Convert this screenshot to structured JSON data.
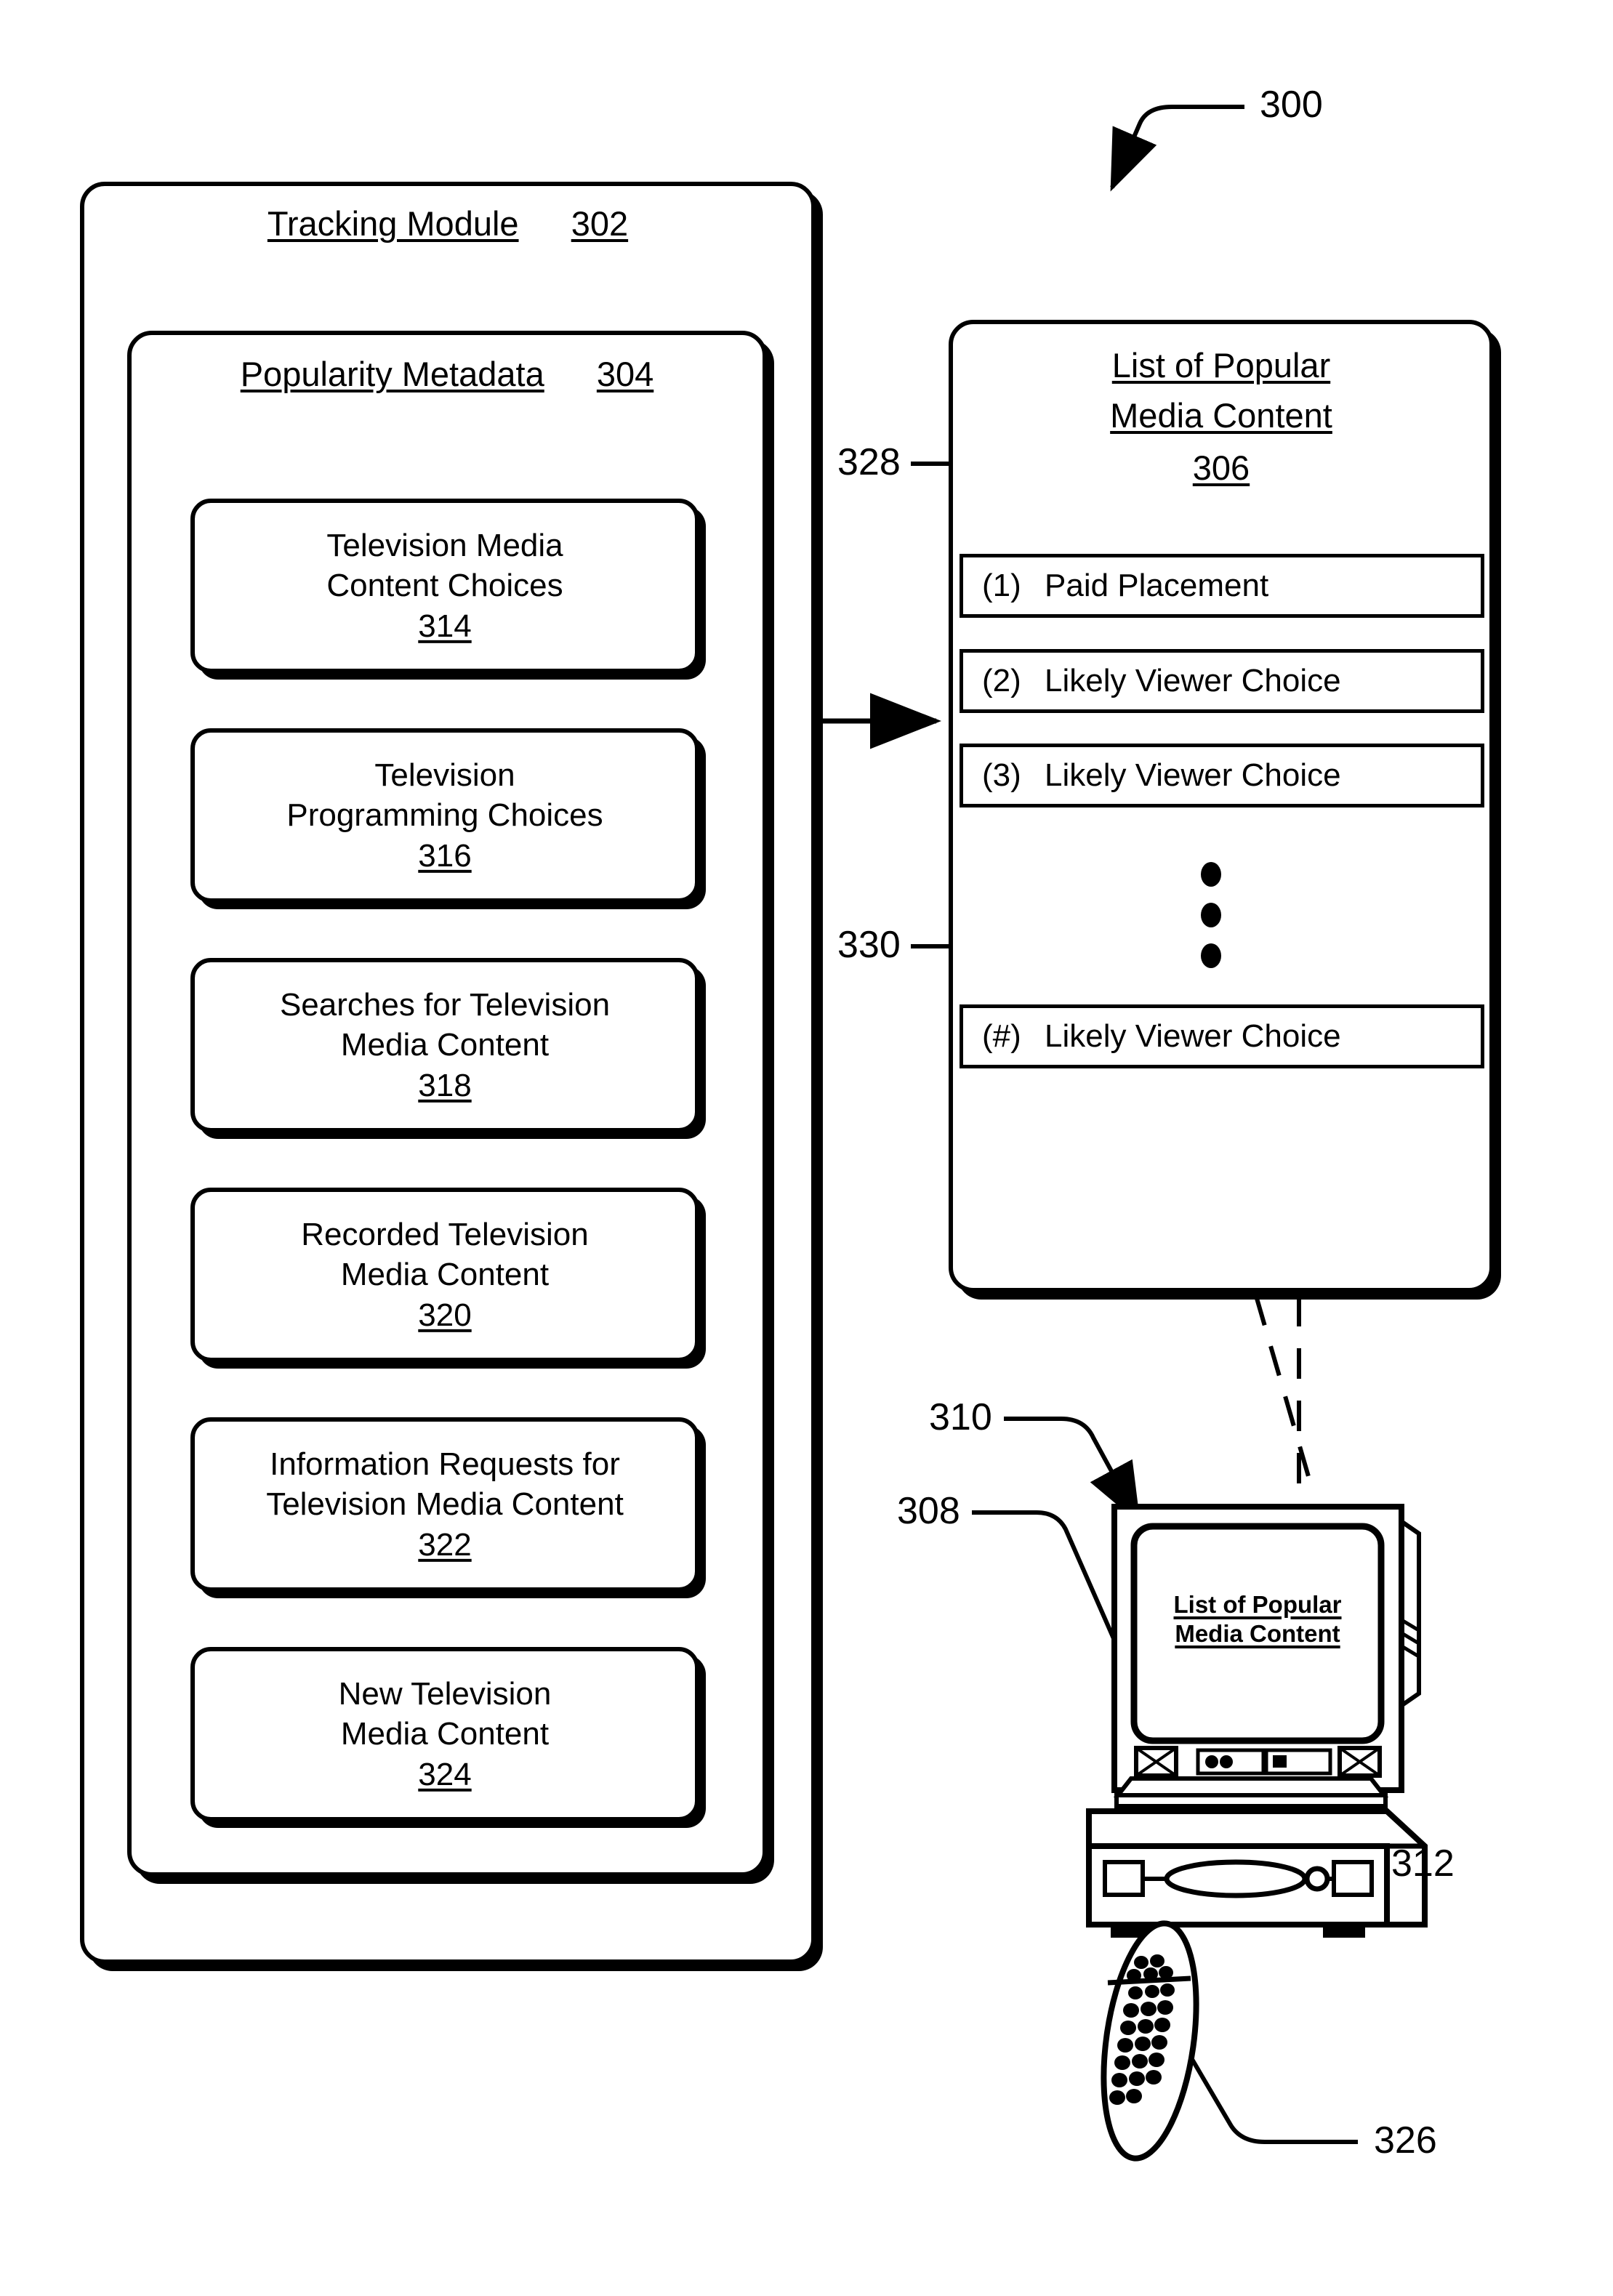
{
  "figure": {
    "number": "300"
  },
  "tracking_module": {
    "title": "Tracking Module",
    "ref": "302"
  },
  "popularity_metadata": {
    "title": "Popularity Metadata",
    "ref": "304",
    "items": [
      {
        "lines": [
          "Television Media",
          "Content Choices"
        ],
        "ref": "314"
      },
      {
        "lines": [
          "Television",
          "Programming Choices"
        ],
        "ref": "316"
      },
      {
        "lines": [
          "Searches for Television",
          "Media Content"
        ],
        "ref": "318"
      },
      {
        "lines": [
          "Recorded Television",
          "Media Content"
        ],
        "ref": "320"
      },
      {
        "lines": [
          "Information Requests for",
          "Television Media Content"
        ],
        "ref": "322"
      },
      {
        "lines": [
          "New Television",
          "Media Content"
        ],
        "ref": "324"
      }
    ]
  },
  "popular_list": {
    "title_line1": "List of Popular",
    "title_line2": "Media Content",
    "ref": "306",
    "first_item_ref": "328",
    "ellipsis_ref": "330",
    "rows": [
      {
        "rank": "(1)",
        "text": "Paid Placement"
      },
      {
        "rank": "(2)",
        "text": "Likely Viewer Choice"
      },
      {
        "rank": "(3)",
        "text": "Likely Viewer Choice"
      },
      {
        "rank": "(#)",
        "text": "Likely Viewer Choice"
      }
    ]
  },
  "device": {
    "display_ref": "310",
    "monitor_ref": "308",
    "receiver_ref": "312",
    "remote_ref": "326",
    "screen_line1": "List of Popular",
    "screen_line2": "Media Content"
  }
}
